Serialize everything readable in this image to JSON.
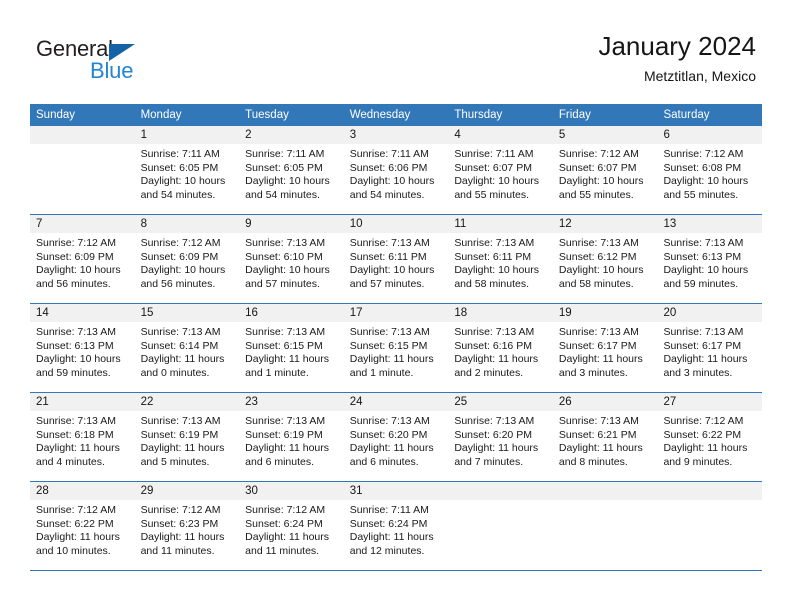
{
  "brand": {
    "name_part1": "General",
    "name_part2": "Blue",
    "triangle_color": "#1464a5",
    "blue_text_color": "#2585d3"
  },
  "header": {
    "title": "January 2024",
    "subtitle": "Metztitlan, Mexico",
    "header_bg_color": "#3277b8",
    "day_band_color": "#f1f1f1"
  },
  "weekdays": [
    "Sunday",
    "Monday",
    "Tuesday",
    "Wednesday",
    "Thursday",
    "Friday",
    "Saturday"
  ],
  "weeks": [
    [
      {
        "day": "",
        "empty": true,
        "sunrise": "",
        "sunset": "",
        "daylight1": "",
        "daylight2": ""
      },
      {
        "day": "1",
        "sunrise": "Sunrise: 7:11 AM",
        "sunset": "Sunset: 6:05 PM",
        "daylight1": "Daylight: 10 hours",
        "daylight2": "and 54 minutes."
      },
      {
        "day": "2",
        "sunrise": "Sunrise: 7:11 AM",
        "sunset": "Sunset: 6:05 PM",
        "daylight1": "Daylight: 10 hours",
        "daylight2": "and 54 minutes."
      },
      {
        "day": "3",
        "sunrise": "Sunrise: 7:11 AM",
        "sunset": "Sunset: 6:06 PM",
        "daylight1": "Daylight: 10 hours",
        "daylight2": "and 54 minutes."
      },
      {
        "day": "4",
        "sunrise": "Sunrise: 7:11 AM",
        "sunset": "Sunset: 6:07 PM",
        "daylight1": "Daylight: 10 hours",
        "daylight2": "and 55 minutes."
      },
      {
        "day": "5",
        "sunrise": "Sunrise: 7:12 AM",
        "sunset": "Sunset: 6:07 PM",
        "daylight1": "Daylight: 10 hours",
        "daylight2": "and 55 minutes."
      },
      {
        "day": "6",
        "sunrise": "Sunrise: 7:12 AM",
        "sunset": "Sunset: 6:08 PM",
        "daylight1": "Daylight: 10 hours",
        "daylight2": "and 55 minutes."
      }
    ],
    [
      {
        "day": "7",
        "sunrise": "Sunrise: 7:12 AM",
        "sunset": "Sunset: 6:09 PM",
        "daylight1": "Daylight: 10 hours",
        "daylight2": "and 56 minutes."
      },
      {
        "day": "8",
        "sunrise": "Sunrise: 7:12 AM",
        "sunset": "Sunset: 6:09 PM",
        "daylight1": "Daylight: 10 hours",
        "daylight2": "and 56 minutes."
      },
      {
        "day": "9",
        "sunrise": "Sunrise: 7:13 AM",
        "sunset": "Sunset: 6:10 PM",
        "daylight1": "Daylight: 10 hours",
        "daylight2": "and 57 minutes."
      },
      {
        "day": "10",
        "sunrise": "Sunrise: 7:13 AM",
        "sunset": "Sunset: 6:11 PM",
        "daylight1": "Daylight: 10 hours",
        "daylight2": "and 57 minutes."
      },
      {
        "day": "11",
        "sunrise": "Sunrise: 7:13 AM",
        "sunset": "Sunset: 6:11 PM",
        "daylight1": "Daylight: 10 hours",
        "daylight2": "and 58 minutes."
      },
      {
        "day": "12",
        "sunrise": "Sunrise: 7:13 AM",
        "sunset": "Sunset: 6:12 PM",
        "daylight1": "Daylight: 10 hours",
        "daylight2": "and 58 minutes."
      },
      {
        "day": "13",
        "sunrise": "Sunrise: 7:13 AM",
        "sunset": "Sunset: 6:13 PM",
        "daylight1": "Daylight: 10 hours",
        "daylight2": "and 59 minutes."
      }
    ],
    [
      {
        "day": "14",
        "sunrise": "Sunrise: 7:13 AM",
        "sunset": "Sunset: 6:13 PM",
        "daylight1": "Daylight: 10 hours",
        "daylight2": "and 59 minutes."
      },
      {
        "day": "15",
        "sunrise": "Sunrise: 7:13 AM",
        "sunset": "Sunset: 6:14 PM",
        "daylight1": "Daylight: 11 hours",
        "daylight2": "and 0 minutes."
      },
      {
        "day": "16",
        "sunrise": "Sunrise: 7:13 AM",
        "sunset": "Sunset: 6:15 PM",
        "daylight1": "Daylight: 11 hours",
        "daylight2": "and 1 minute."
      },
      {
        "day": "17",
        "sunrise": "Sunrise: 7:13 AM",
        "sunset": "Sunset: 6:15 PM",
        "daylight1": "Daylight: 11 hours",
        "daylight2": "and 1 minute."
      },
      {
        "day": "18",
        "sunrise": "Sunrise: 7:13 AM",
        "sunset": "Sunset: 6:16 PM",
        "daylight1": "Daylight: 11 hours",
        "daylight2": "and 2 minutes."
      },
      {
        "day": "19",
        "sunrise": "Sunrise: 7:13 AM",
        "sunset": "Sunset: 6:17 PM",
        "daylight1": "Daylight: 11 hours",
        "daylight2": "and 3 minutes."
      },
      {
        "day": "20",
        "sunrise": "Sunrise: 7:13 AM",
        "sunset": "Sunset: 6:17 PM",
        "daylight1": "Daylight: 11 hours",
        "daylight2": "and 3 minutes."
      }
    ],
    [
      {
        "day": "21",
        "sunrise": "Sunrise: 7:13 AM",
        "sunset": "Sunset: 6:18 PM",
        "daylight1": "Daylight: 11 hours",
        "daylight2": "and 4 minutes."
      },
      {
        "day": "22",
        "sunrise": "Sunrise: 7:13 AM",
        "sunset": "Sunset: 6:19 PM",
        "daylight1": "Daylight: 11 hours",
        "daylight2": "and 5 minutes."
      },
      {
        "day": "23",
        "sunrise": "Sunrise: 7:13 AM",
        "sunset": "Sunset: 6:19 PM",
        "daylight1": "Daylight: 11 hours",
        "daylight2": "and 6 minutes."
      },
      {
        "day": "24",
        "sunrise": "Sunrise: 7:13 AM",
        "sunset": "Sunset: 6:20 PM",
        "daylight1": "Daylight: 11 hours",
        "daylight2": "and 6 minutes."
      },
      {
        "day": "25",
        "sunrise": "Sunrise: 7:13 AM",
        "sunset": "Sunset: 6:20 PM",
        "daylight1": "Daylight: 11 hours",
        "daylight2": "and 7 minutes."
      },
      {
        "day": "26",
        "sunrise": "Sunrise: 7:13 AM",
        "sunset": "Sunset: 6:21 PM",
        "daylight1": "Daylight: 11 hours",
        "daylight2": "and 8 minutes."
      },
      {
        "day": "27",
        "sunrise": "Sunrise: 7:12 AM",
        "sunset": "Sunset: 6:22 PM",
        "daylight1": "Daylight: 11 hours",
        "daylight2": "and 9 minutes."
      }
    ],
    [
      {
        "day": "28",
        "sunrise": "Sunrise: 7:12 AM",
        "sunset": "Sunset: 6:22 PM",
        "daylight1": "Daylight: 11 hours",
        "daylight2": "and 10 minutes."
      },
      {
        "day": "29",
        "sunrise": "Sunrise: 7:12 AM",
        "sunset": "Sunset: 6:23 PM",
        "daylight1": "Daylight: 11 hours",
        "daylight2": "and 11 minutes."
      },
      {
        "day": "30",
        "sunrise": "Sunrise: 7:12 AM",
        "sunset": "Sunset: 6:24 PM",
        "daylight1": "Daylight: 11 hours",
        "daylight2": "and 11 minutes."
      },
      {
        "day": "31",
        "sunrise": "Sunrise: 7:11 AM",
        "sunset": "Sunset: 6:24 PM",
        "daylight1": "Daylight: 11 hours",
        "daylight2": "and 12 minutes."
      },
      {
        "day": "",
        "empty": true,
        "sunrise": "",
        "sunset": "",
        "daylight1": "",
        "daylight2": ""
      },
      {
        "day": "",
        "empty": true,
        "sunrise": "",
        "sunset": "",
        "daylight1": "",
        "daylight2": ""
      },
      {
        "day": "",
        "empty": true,
        "sunrise": "",
        "sunset": "",
        "daylight1": "",
        "daylight2": ""
      }
    ]
  ]
}
